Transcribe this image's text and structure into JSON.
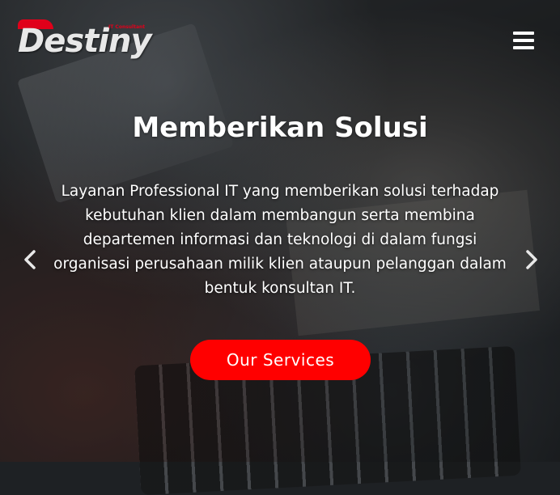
{
  "brand": {
    "name": "Destiny",
    "tagline": "IT Consultant"
  },
  "nav": {
    "menu_icon": "hamburger-menu-icon"
  },
  "hero": {
    "title": "Memberikan Solusi",
    "description": "Layanan Professional IT yang memberikan solusi terhadap kebutuhan klien dalam membangun serta membina departemen informasi dan teknologi di dalam fungsi organisasi perusahaan milik klien ataupun pelanggan dalam bentuk konsultan IT.",
    "cta_label": "Our Services",
    "prev_icon": "chevron-left-icon",
    "next_icon": "chevron-right-icon"
  },
  "colors": {
    "accent": "#ff0000",
    "text": "#ffffff"
  }
}
